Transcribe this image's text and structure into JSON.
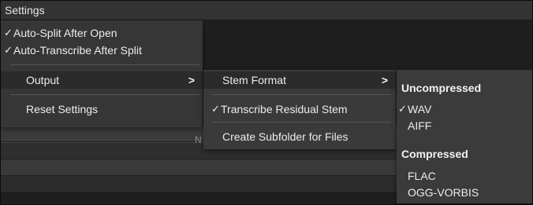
{
  "menu_bar": {
    "title": "Settings"
  },
  "background": {
    "partial_text": "N"
  },
  "main_menu": {
    "items": [
      {
        "label": "Auto-Split After Open",
        "checked": true
      },
      {
        "label": "Auto-Transcribe After Split",
        "checked": true
      },
      {
        "label": "Output",
        "has_submenu": true
      },
      {
        "label": "Reset Settings"
      }
    ]
  },
  "output_menu": {
    "items": [
      {
        "label": "Stem Format",
        "has_submenu": true
      },
      {
        "label": "Transcribe Residual Stem",
        "checked": true
      },
      {
        "label": "Create Subfolder for Files"
      }
    ]
  },
  "stem_format_menu": {
    "sections": [
      {
        "heading": "Uncompressed",
        "items": [
          {
            "label": "WAV",
            "checked": true
          },
          {
            "label": "AIFF"
          }
        ]
      },
      {
        "heading": "Compressed",
        "items": [
          {
            "label": "FLAC"
          },
          {
            "label": "OGG-VORBIS"
          }
        ]
      }
    ]
  },
  "glyphs": {
    "check": "✓",
    "arrow": ">"
  },
  "colors": {
    "menu_bg": "#363636",
    "highlight": "#2b2b2b",
    "text": "#ececec"
  }
}
